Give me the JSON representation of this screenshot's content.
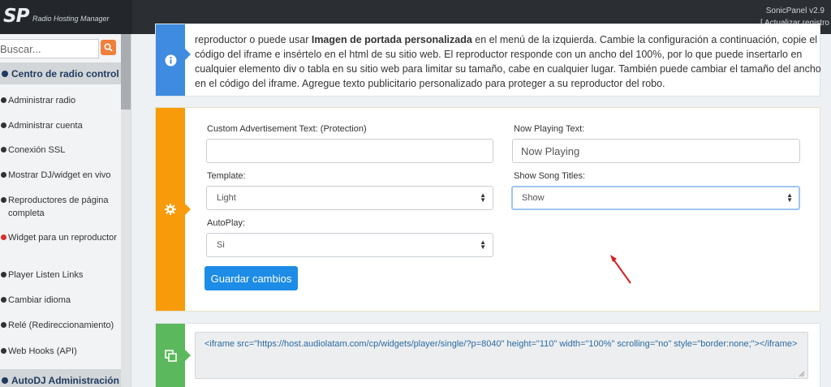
{
  "header": {
    "logo_text": "SP",
    "logo_subtitle": "Radio Hosting Manager",
    "version": "SonicPanel v2.9",
    "refresh_link": "[ Actualizar registro"
  },
  "sidebar": {
    "search_placeholder": "Buscar...",
    "section_radio": "Centro de radio control",
    "items": [
      {
        "label": "Administrar radio"
      },
      {
        "label": "Administrar cuenta"
      },
      {
        "label": "Conexión SSL"
      },
      {
        "label": "Mostrar DJ/widget en vivo"
      },
      {
        "label": "Reproductores de página completa"
      },
      {
        "label": "Widget para un reproductor"
      },
      {
        "label": "Player Listen Links"
      },
      {
        "label": "Cambiar idioma"
      },
      {
        "label": "Relé (Redireccionamiento)"
      },
      {
        "label": "Web Hooks (API)"
      }
    ],
    "section_autodj": "AutoDJ Administración"
  },
  "info_panel": {
    "text_before_bold": "reproductor o puede usar ",
    "text_bold": "Imagen de portada personalizada",
    "text_after_bold": " en el menú de la izquierda. Cambie la configuración a continuación, copie el código del iframe e insértelo en el html de su sitio web. El reproductor responde con un ancho del 100%, por lo que puede insertarlo en cualquier elemento div o tabla en su sitio web para limitar su tamaño, cabe en cualquier lugar. También puede cambiar el tamaño del ancho en el código del iframe. Agregue texto publicitario personalizado para proteger a su reproductor del robo."
  },
  "form": {
    "ad_text_label": "Custom Advertisement Text: (Protection)",
    "ad_text_value": "",
    "now_playing_label": "Now Playing Text:",
    "now_playing_value": "Now Playing",
    "template_label": "Template:",
    "template_value": "Light",
    "song_titles_label": "Show Song Titles:",
    "song_titles_value": "Show",
    "autoplay_label": "AutoPlay:",
    "autoplay_value": "Si",
    "save_label": "Guardar cambios"
  },
  "code_panel": {
    "iframe_code": "<iframe src=\"https://host.audiolatam.com/cp/widgets/player/single/?p=8040\" height=\"110\" width=\"100%\" scrolling=\"no\" style=\"border:none;\"></iframe>"
  },
  "colors": {
    "topbar": "#2b2f33",
    "info_tab": "#3e8be0",
    "settings_tab": "#f89b0a",
    "code_tab": "#5cb85c",
    "primary_button": "#1d8ce6",
    "search_button": "#f07f3c",
    "annotation_arrow": "#d42020"
  },
  "icons": {
    "info": "info-circle-icon",
    "settings": "gear-icon",
    "code": "copy-icon",
    "search": "search-icon"
  }
}
